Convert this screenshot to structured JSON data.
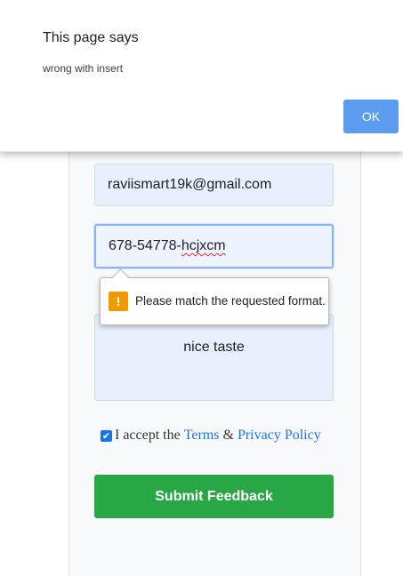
{
  "dialog": {
    "title": "This page says",
    "message": "wrong with insert",
    "ok_label": "OK"
  },
  "form": {
    "email_value": "raviismart19k@gmail.com",
    "phone_value_prefix": "678-54778-",
    "phone_value_misspelled": "hcjxcm",
    "message_value": "nice taste",
    "validation_message": "Please match the requested format.",
    "validation_icon": "!",
    "consent": {
      "checked": true,
      "check_glyph": "✔",
      "prefix": "I accept the ",
      "terms_link": "Terms",
      "joiner": " & ",
      "privacy_link": "Privacy Policy"
    },
    "submit_label": "Submit Feedback"
  },
  "colors": {
    "ok_button": "#5b9bf0",
    "input_fill": "#e8f0fe",
    "link": "#1a73e8",
    "submit_button": "#28a745",
    "warning": "#f29900"
  }
}
